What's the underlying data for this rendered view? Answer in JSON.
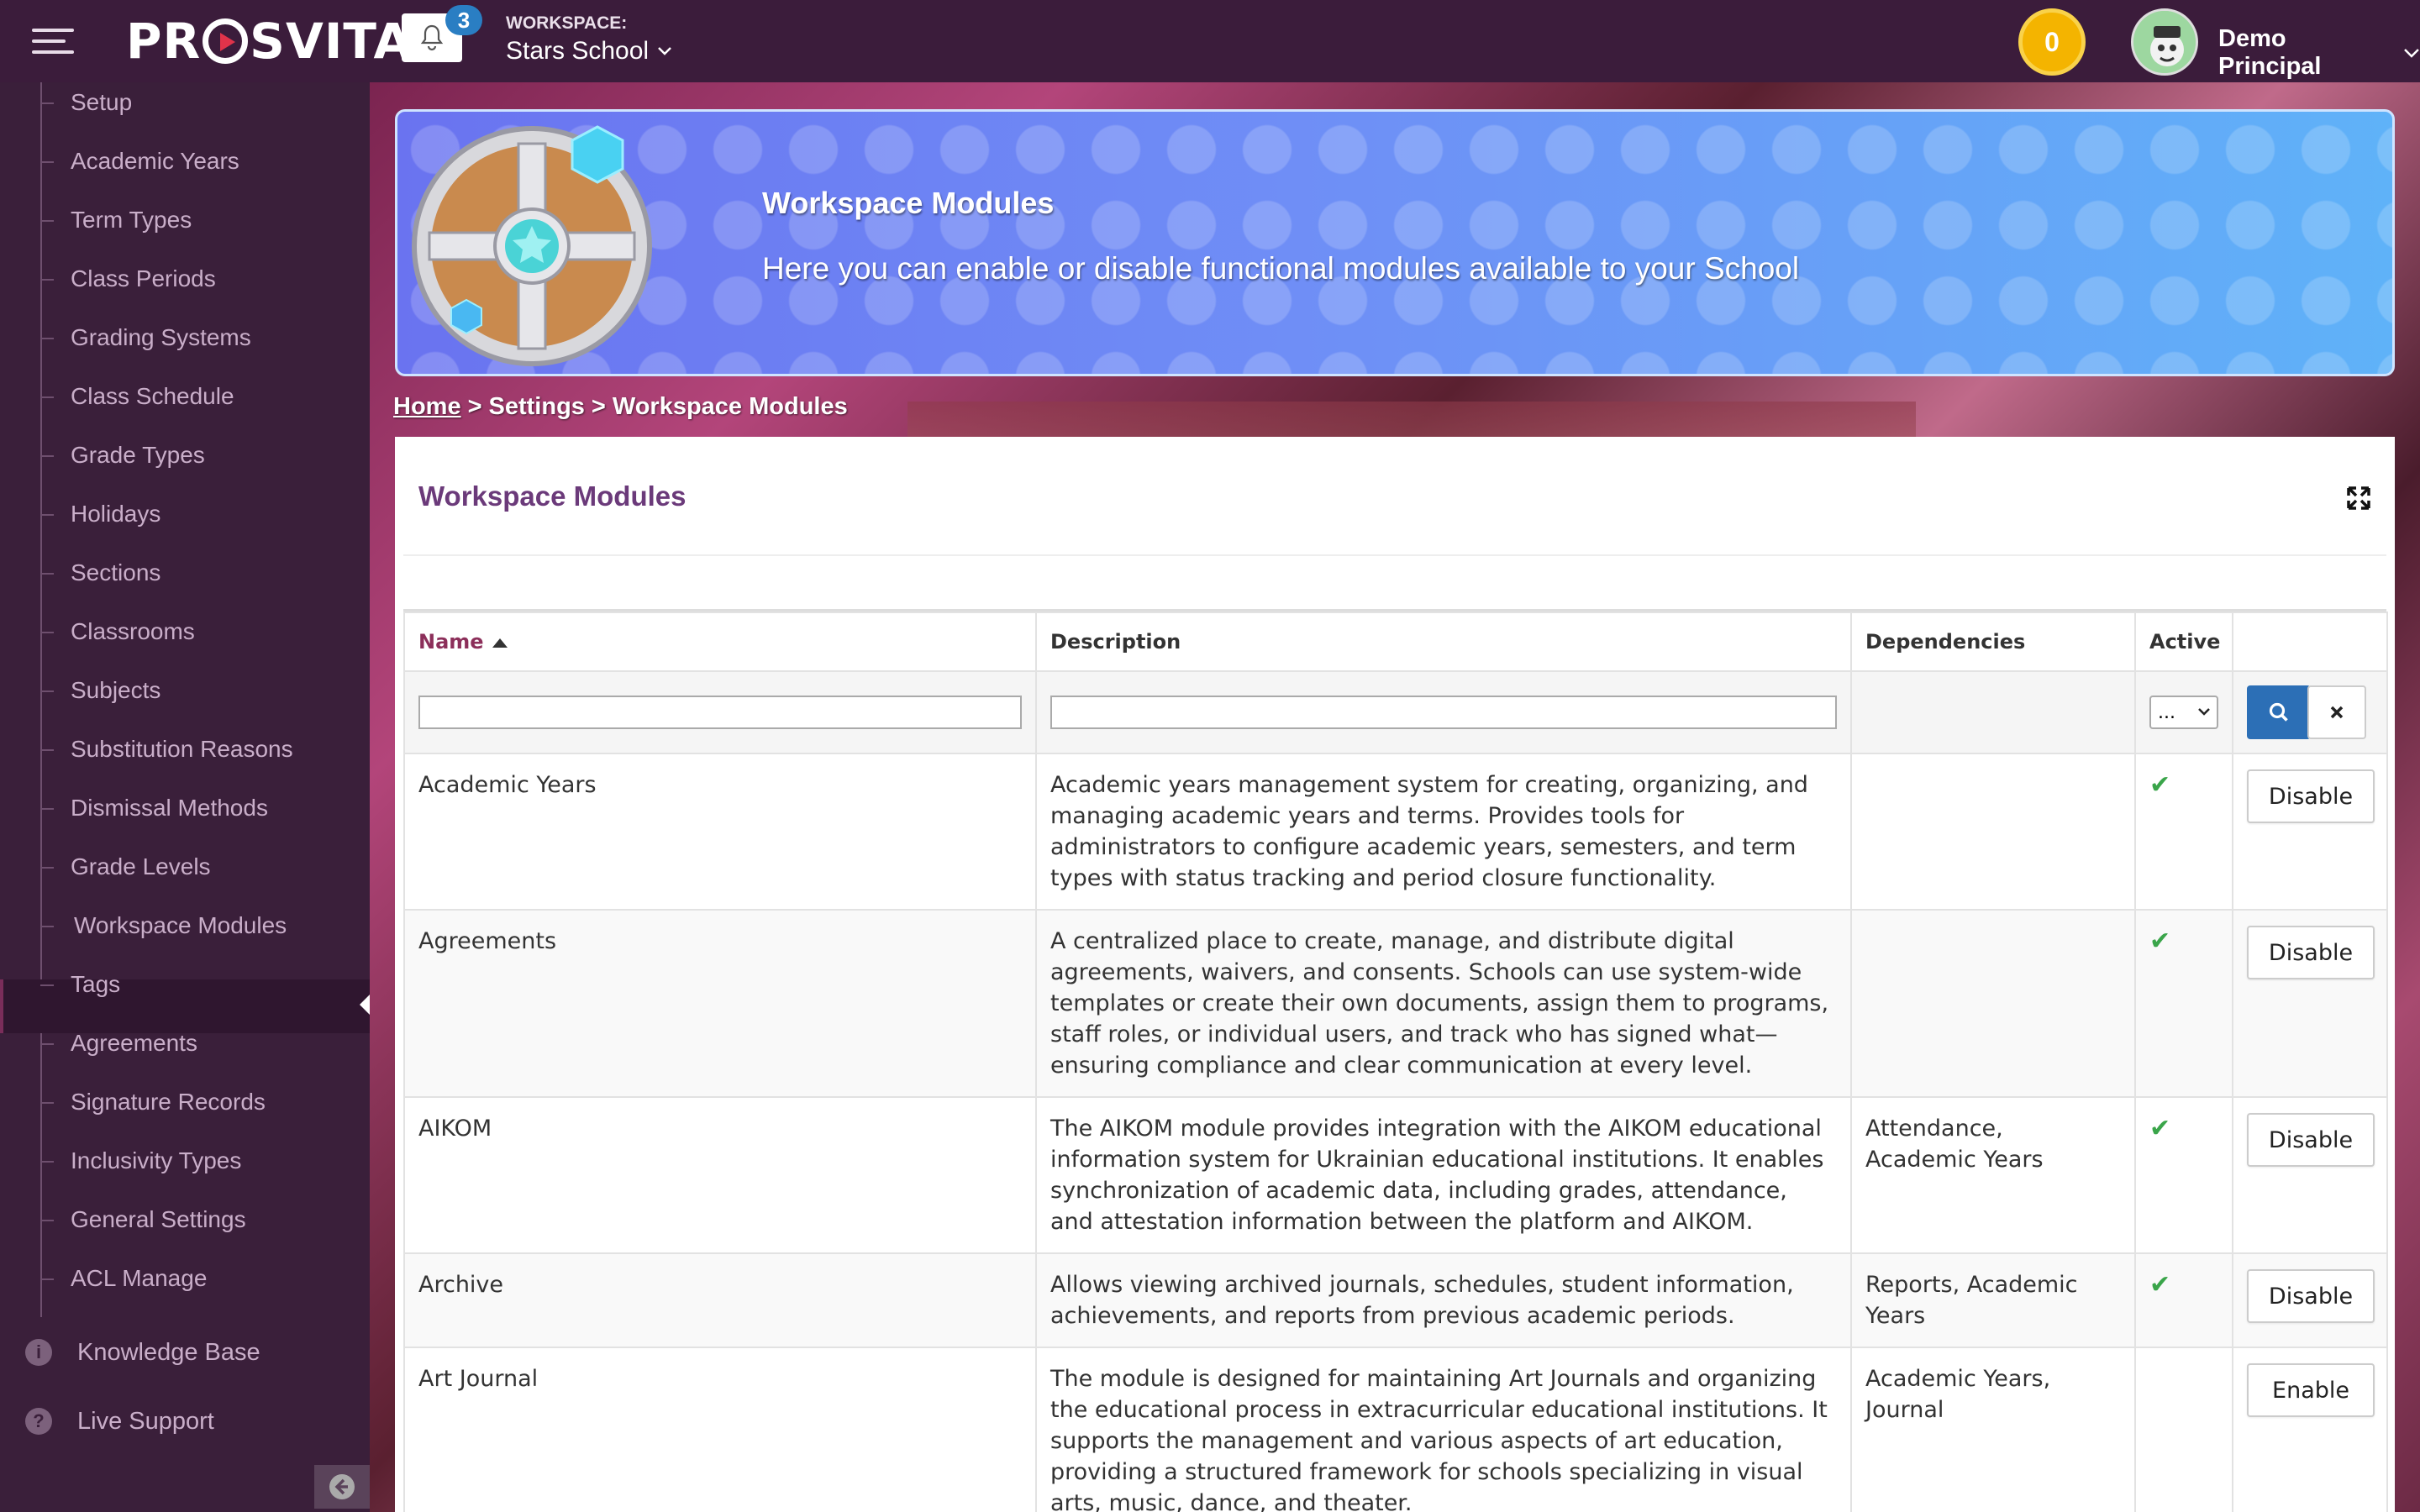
{
  "header": {
    "logo_text": "PROSVITA",
    "notification_count": "3",
    "workspace_label": "WORKSPACE:",
    "workspace_value": "Stars School",
    "coins": "0",
    "user_name": "Demo Principal"
  },
  "sidebar": {
    "items": [
      {
        "label": "Setup"
      },
      {
        "label": "Academic Years"
      },
      {
        "label": "Term Types"
      },
      {
        "label": "Class Periods"
      },
      {
        "label": "Grading Systems"
      },
      {
        "label": "Class Schedule"
      },
      {
        "label": "Grade Types"
      },
      {
        "label": "Holidays"
      },
      {
        "label": "Sections"
      },
      {
        "label": "Classrooms"
      },
      {
        "label": "Subjects"
      },
      {
        "label": "Substitution Reasons"
      },
      {
        "label": "Dismissal Methods"
      },
      {
        "label": "Grade Levels"
      },
      {
        "label": "Workspace Modules"
      },
      {
        "label": "Tags"
      },
      {
        "label": "Agreements"
      },
      {
        "label": "Signature Records"
      },
      {
        "label": "Inclusivity Types"
      },
      {
        "label": "General Settings"
      },
      {
        "label": "ACL Manage"
      }
    ],
    "active_item": "Workspace Modules",
    "bottom": {
      "knowledge_base": "Knowledge Base",
      "live_support": "Live Support"
    }
  },
  "banner": {
    "title": "Workspace Modules",
    "subtitle": "Here you can enable or disable functional modules available to your School"
  },
  "breadcrumb": {
    "home": "Home",
    "sep1": ">",
    "settings": "Settings",
    "sep2": ">",
    "current": "Workspace Modules"
  },
  "panel": {
    "title": "Workspace Modules"
  },
  "table": {
    "columns": {
      "name": "Name",
      "description": "Description",
      "dependencies": "Dependencies",
      "active": "Active"
    },
    "active_filter_value": "...",
    "rows": [
      {
        "name": "Academic Years",
        "description": "Academic years management system for creating, organizing, and managing academic years and terms. Provides tools for administrators to configure academic years, semesters, and term types with status tracking and period closure functionality.",
        "dependencies": "",
        "active": "✔",
        "action": "Disable"
      },
      {
        "name": "Agreements",
        "description": "A centralized place to create, manage, and distribute digital agreements, waivers, and consents. Schools can use system-wide templates or create their own documents, assign them to programs, staff roles, or individual users, and track who has signed what—ensuring compliance and clear communication at every level.",
        "dependencies": "",
        "active": "✔",
        "action": "Disable"
      },
      {
        "name": "AIKOM",
        "description": "The AIKOM module provides integration with the AIKOM educational information system for Ukrainian educational institutions. It enables synchronization of academic data, including grades, attendance, and attestation information between the platform and AIKOM.",
        "dependencies": "Attendance, Academic Years",
        "active": "✔",
        "action": "Disable"
      },
      {
        "name": "Archive",
        "description": "Allows viewing archived journals, schedules, student information, achievements, and reports from previous academic periods.",
        "dependencies": "Reports, Academic Years",
        "active": "✔",
        "action": "Disable"
      },
      {
        "name": "Art Journal",
        "description": "The module is designed for maintaining Art Journals and organizing the educational process in extracurricular educational institutions. It supports the management and various aspects of art education, providing a structured framework for schools specializing in visual arts, music, dance, and theater.",
        "dependencies": "Academic Years, Journal",
        "active": "",
        "action": "Enable"
      }
    ]
  },
  "colors": {
    "topbar": "#3b1c3b",
    "sidebar": "#3a1f3a",
    "accent": "#6b3a7a",
    "search_button": "#2c6fb6",
    "check": "#3aa54a",
    "coin": "#f4b400"
  }
}
